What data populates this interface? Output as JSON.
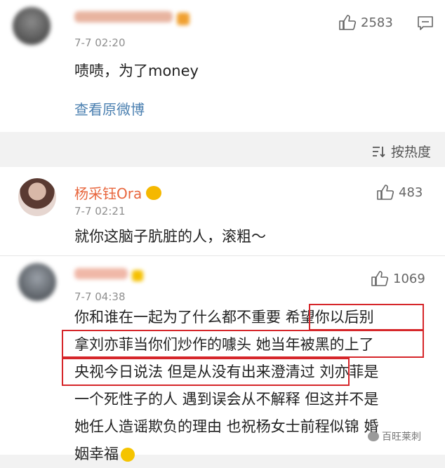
{
  "top_comment": {
    "time": "7-7 02:20",
    "likes": "2583",
    "text": "啧啧，为了money",
    "link": "查看原微博"
  },
  "sort": {
    "label": "按热度"
  },
  "comments": [
    {
      "name": "杨采钰Ora",
      "time": "7-7 02:21",
      "likes": "483",
      "text": "就你这脑子肮脏的人，滚粗～"
    },
    {
      "time": "7-7 04:38",
      "likes": "1069",
      "lines": [
        "你和谁在一起为了什么都不重要 希望你以后别",
        "拿刘亦菲当你们炒作的噱头 她当年被黑的上了",
        "央视今日说法 但是从没有出来澄清过 刘亦菲是",
        "一个死性子的人 遇到误会从不解释 但这并不是",
        "她任人造谣欺负的理由 也祝杨女士前程似锦 婚",
        "姻幸福"
      ]
    }
  ],
  "watermark": "百旺莱刺",
  "colors": {
    "highlight": "#d6262a",
    "link": "#4a7fb0"
  }
}
